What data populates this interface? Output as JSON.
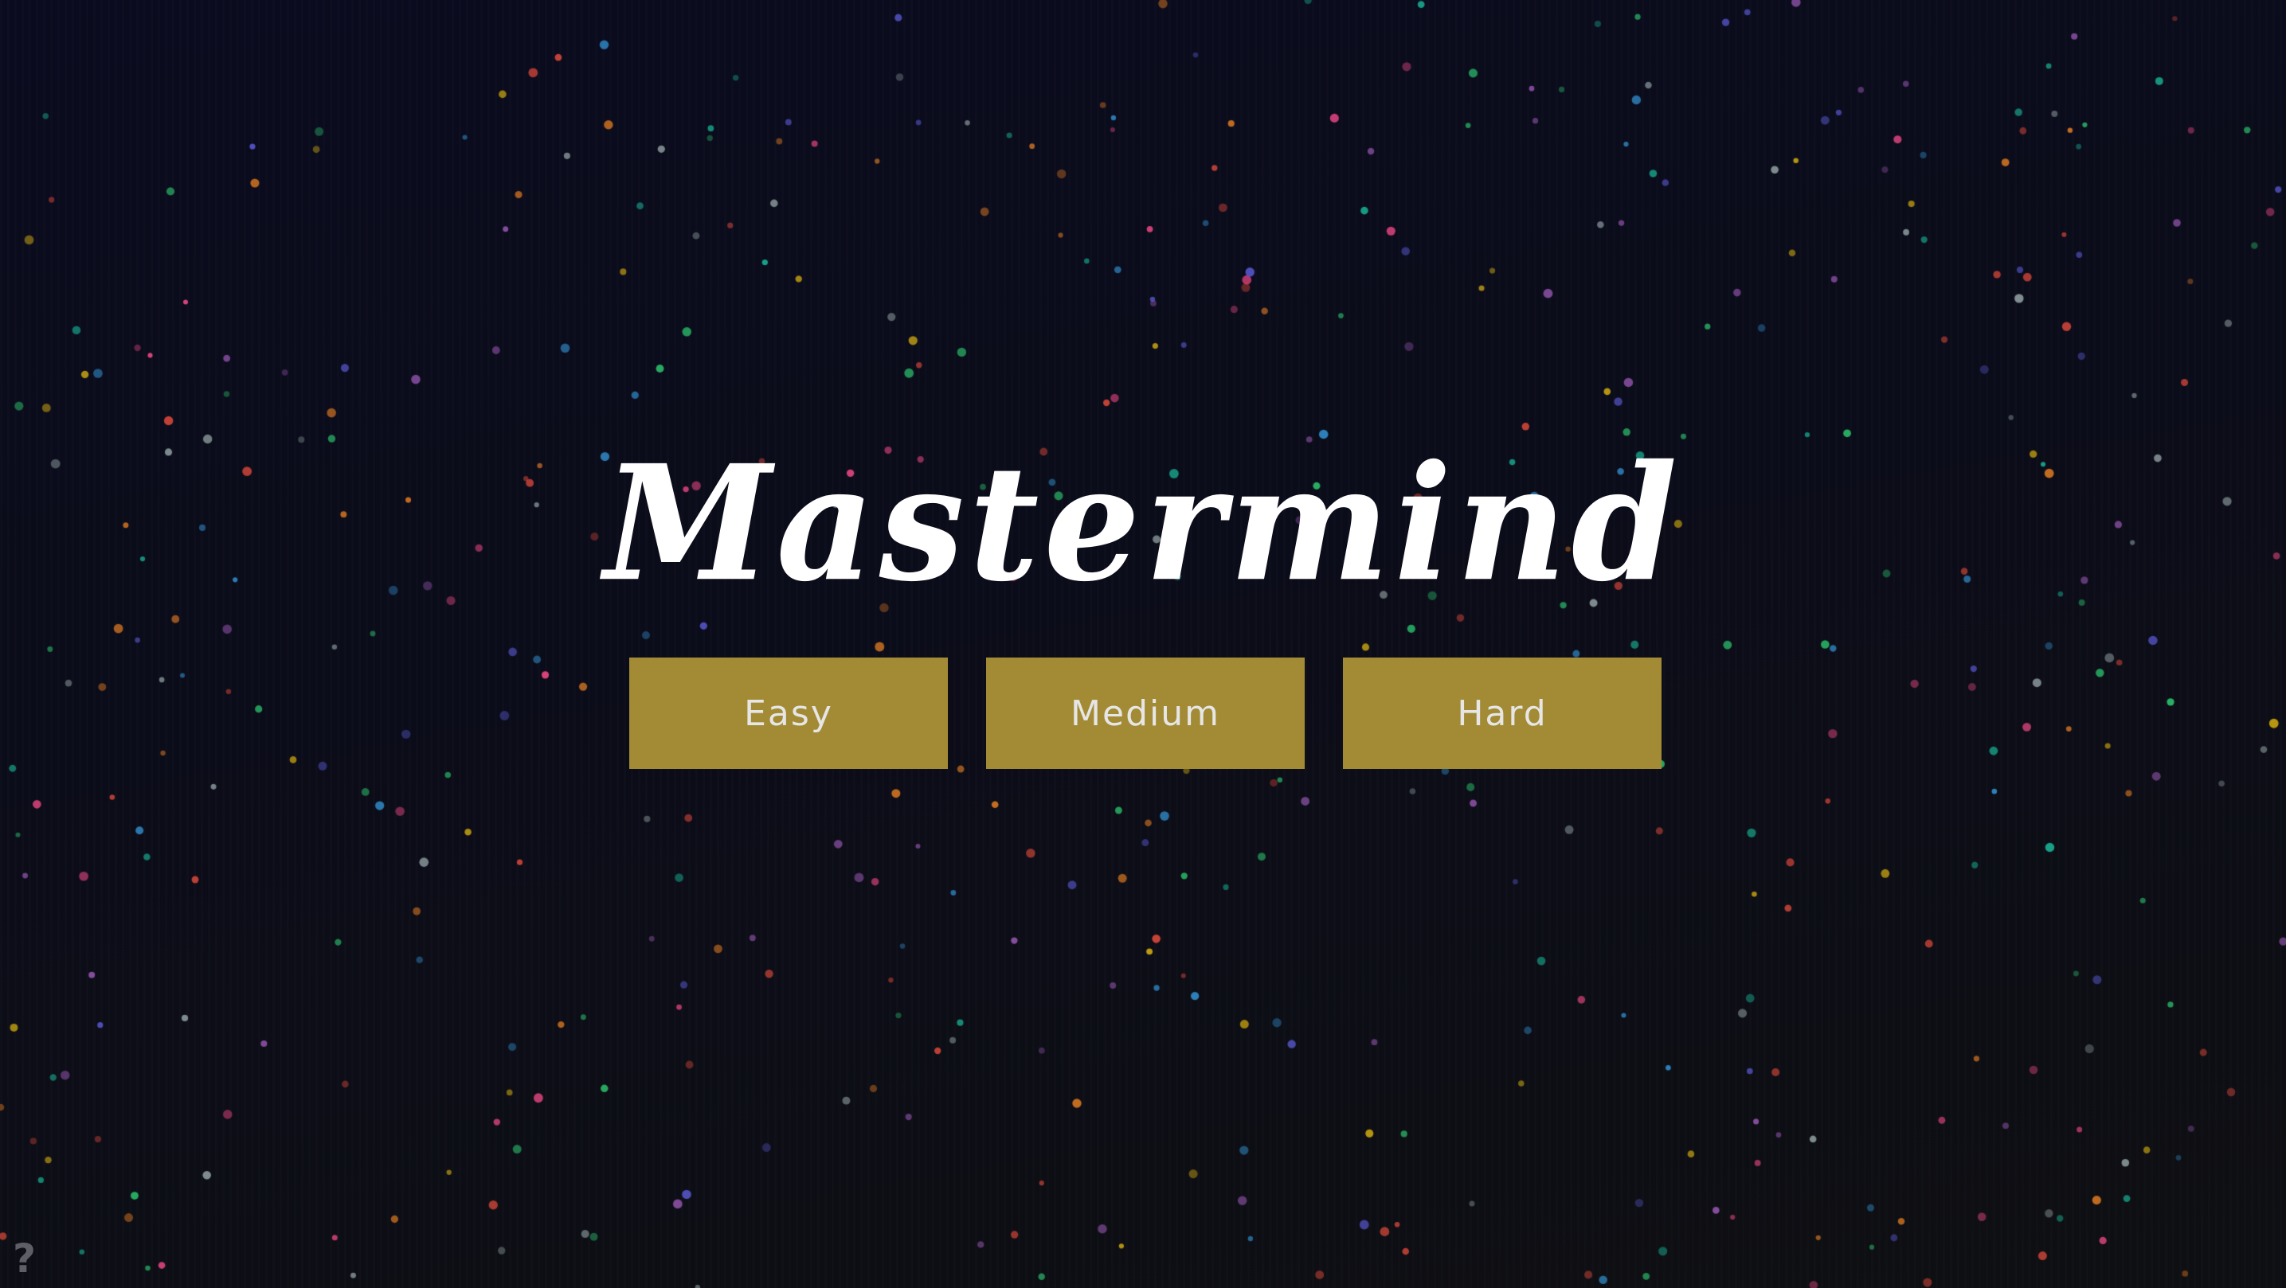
{
  "app": {
    "title": "Mastermind"
  },
  "difficulty_buttons": [
    {
      "label": "Easy"
    },
    {
      "label": "Medium"
    },
    {
      "label": "Hard"
    }
  ],
  "help": {
    "label": "?"
  },
  "colors": {
    "background": "#0a0b1a",
    "button": "#a38b35",
    "button_text": "#e6e6e6",
    "title": "#ffffff",
    "star_palette": [
      "#2ecc71",
      "#e74c3c",
      "#3498db",
      "#9b59b6",
      "#e67e22",
      "#f1c40f",
      "#1abc9c",
      "#95a5a6",
      "#ff4d8d",
      "#5b5bd6"
    ]
  }
}
